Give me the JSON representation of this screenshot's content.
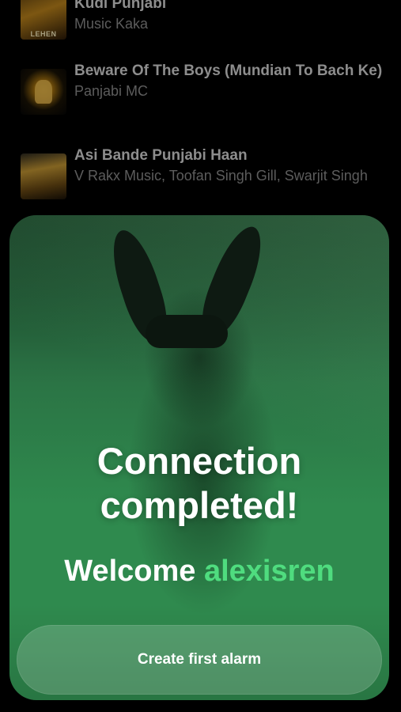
{
  "tracks": [
    {
      "title": "Kudi Punjabi",
      "artist": "Music Kaka",
      "thumb_caption": "LEHEN"
    },
    {
      "title": "Beware Of The Boys (Mundian To Bach Ke)",
      "artist": "Panjabi MC"
    },
    {
      "title": "Asi Bande Punjabi Haan",
      "artist": "V Rakx Music, Toofan Singh Gill, Swarjit Singh"
    }
  ],
  "modal": {
    "heading": "Connection completed!",
    "welcome_prefix": "Welcome",
    "username": "alexisren",
    "cta_label": "Create first alarm"
  },
  "colors": {
    "accent_green": "#4fdc7f",
    "modal_green": "#2f8a4e",
    "background": "#000000"
  }
}
